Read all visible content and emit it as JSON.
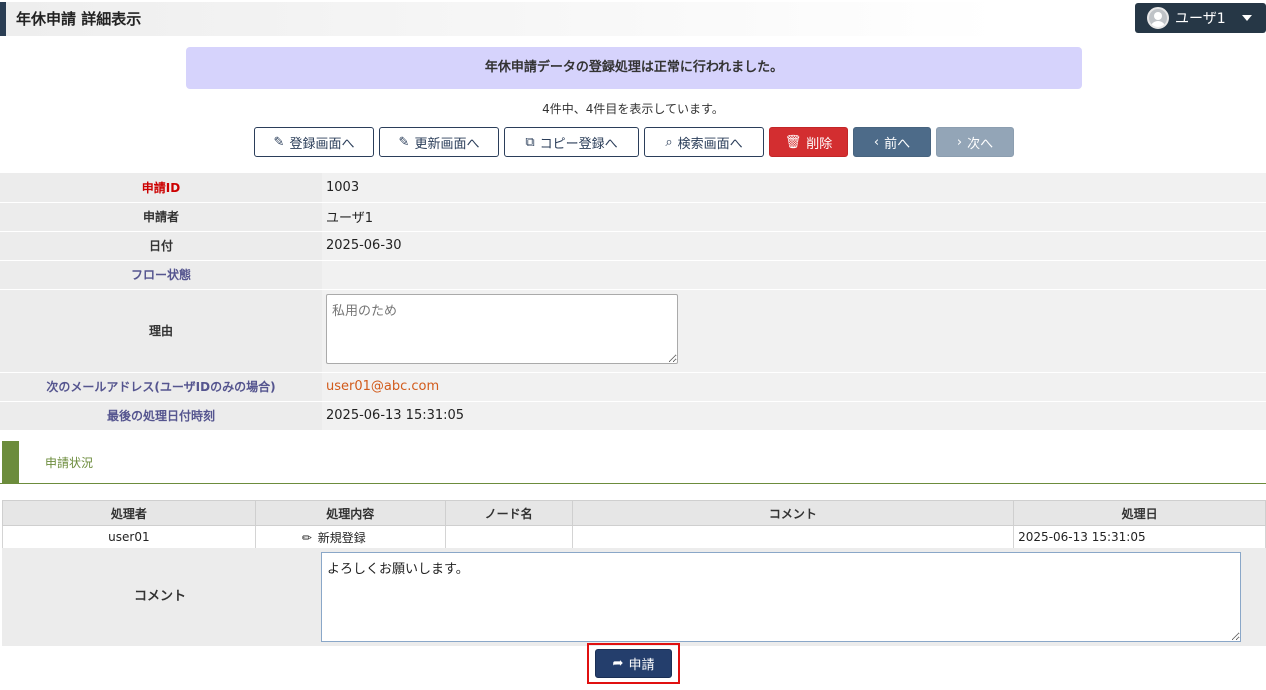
{
  "header": {
    "title": "年休申請 詳細表示",
    "user_label": "ユーザ1"
  },
  "message": "年休申請データの登録処理は正常に行われました。",
  "record_count": "4件中、4件目を表示しています。",
  "toolbar": {
    "register": "登録画面へ",
    "update": "更新画面へ",
    "copy": "コピー登録へ",
    "search": "検索画面へ",
    "delete": "削除",
    "prev": "前へ",
    "next": "次へ"
  },
  "detail": {
    "id_label": "申請ID",
    "id_value": "1003",
    "applicant_label": "申請者",
    "applicant_value": "ユーザ1",
    "date_label": "日付",
    "date_value": "2025-06-30",
    "flow_label": "フロー状態",
    "flow_value": "",
    "reason_label": "理由",
    "reason_placeholder": "私用のため",
    "mail_label": "次のメールアドレス(ユーザIDのみの場合)",
    "mail_value": "user01@abc.com",
    "last_label": "最後の処理日付時刻",
    "last_value": "2025-06-13 15:31:05"
  },
  "section_title": "申請状況",
  "status_table": {
    "headers": [
      "処理者",
      "処理内容",
      "ノード名",
      "コメント",
      "処理日"
    ],
    "row": {
      "processor": "user01",
      "content": "新規登録",
      "node": "",
      "comment": "",
      "date": "2025-06-13 15:31:05"
    }
  },
  "comment": {
    "label": "コメント",
    "value": "よろしくお願いします。"
  },
  "submit_label": "申請",
  "colors": {
    "accent": "#2b3e54",
    "green": "#6c8c3c",
    "delete": "#d32e30",
    "message_bg": "#d6d3fc"
  }
}
